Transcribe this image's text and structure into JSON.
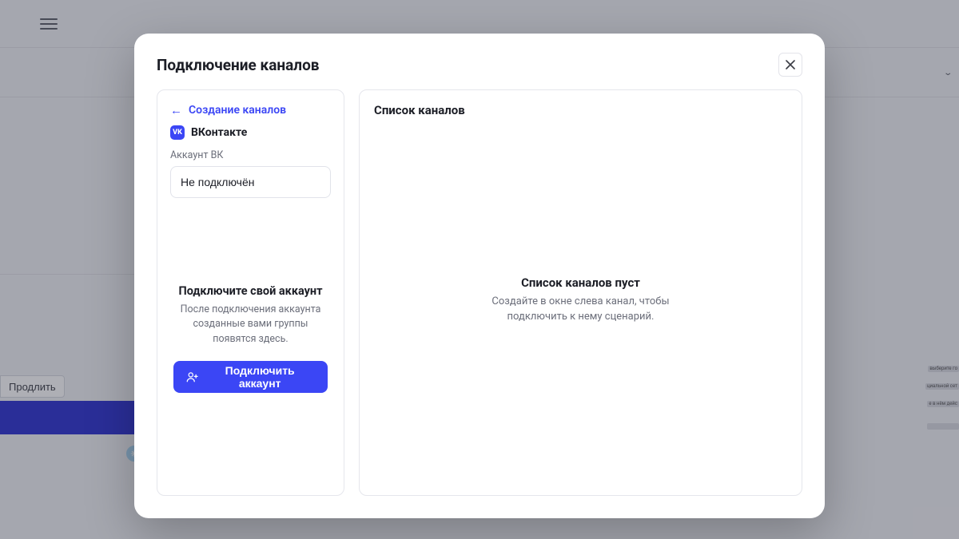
{
  "background": {
    "extend_button": "Продлить",
    "icons": [
      "lb",
      "vk",
      "tg"
    ],
    "right_texts": [
      "выберите го",
      "циальной сет",
      "е в нём дейс"
    ]
  },
  "modal": {
    "title": "Подключение каналов",
    "close_aria": "Close",
    "left": {
      "back_label": "Создание каналов",
      "channel_name": "ВКонтакте",
      "channel_badge": "VK",
      "account_label": "Аккаунт ВК",
      "account_value": "Не подключён",
      "empty_title": "Подключите свой аккаунт",
      "empty_sub": "После подключения аккаунта созданные вами группы появятся здесь.",
      "connect_button": "Подключить аккаунт"
    },
    "right": {
      "title": "Список каналов",
      "empty_title": "Список каналов пуст",
      "empty_sub": "Создайте в окне слева канал, чтобы подключить к нему сценарий."
    }
  }
}
